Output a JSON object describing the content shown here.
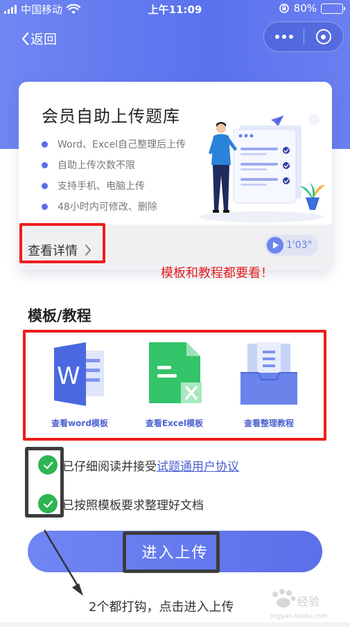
{
  "status_bar": {
    "carrier": "中国移动",
    "time": "上午11:09",
    "battery": "80%"
  },
  "nav": {
    "back_label": "返回"
  },
  "card": {
    "title": "会员自助上传题库",
    "features": [
      "Word、Excel自己整理后上传",
      "自助上传次数不限",
      "支持手机、电脑上传",
      "48小时内可修改、删除"
    ],
    "detail_label": "查看详情",
    "voice_duration": "1'03\""
  },
  "annotations": {
    "red_note": "模板和教程都要看！",
    "bottom_note": "2个都打钩，点击进入上传"
  },
  "section": {
    "title": "模板/教程"
  },
  "templates": [
    {
      "label": "查看word模板"
    },
    {
      "label": "查看Excel模板"
    },
    {
      "label": "查看整理教程"
    }
  ],
  "checks": {
    "item1_text": "已仔细阅读并接受",
    "item1_link": "试题通用户协议",
    "item2_text": "已按照模板要求整理好文档"
  },
  "upload": {
    "label": "进入上传"
  },
  "watermark": {
    "text": "经验",
    "subtext": "jingyan.baidu.com"
  },
  "colors": {
    "accent": "#5b6fe9",
    "check": "#2eb451",
    "annotation": "#ee1c1c"
  }
}
